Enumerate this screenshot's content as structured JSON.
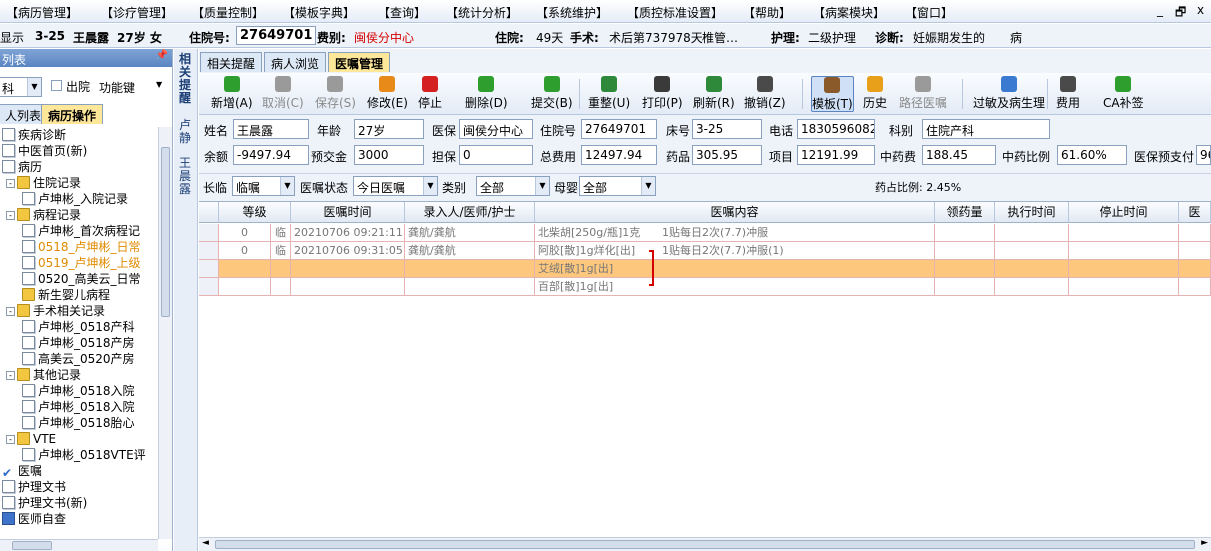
{
  "menu": [
    "【病历管理】",
    "【诊疗管理】",
    "【质量控制】",
    "【模板字典】",
    "【查询】",
    "【统计分析】",
    "【系统维护】",
    "【质控标准设置】",
    "【帮助】",
    "【病案模块】",
    "【窗口】"
  ],
  "window_controls": [
    "_",
    "🗗",
    "x"
  ],
  "infobar": {
    "prefix": "显示",
    "bed": "3-25",
    "patient_name": "王晨露",
    "age_sex": "27岁 女",
    "admission_label": "住院号:",
    "admission_no": "27649701",
    "fee_type_label": "费别:",
    "fee_type": "闽侯分中心",
    "stay_label": "住院:",
    "stay_days": "49天",
    "surgery_label": "手术:",
    "surgery": "术后第737978天",
    "surgery_more": "椎管…",
    "nursing_label": "护理:",
    "nursing": "二级护理",
    "diagnosis_label": "诊断:",
    "diagnosis": "妊娠期发生的",
    "diagnosis_more": "病"
  },
  "left_panel": {
    "title": "列表",
    "combo_value": "科",
    "checkbox_label": "出院",
    "function_key": "功能键",
    "tabs": [
      "人列表",
      "病历操作"
    ],
    "tree": [
      {
        "label": "疾病诊断",
        "level": 0,
        "icon": "doc"
      },
      {
        "label": "中医首页(新)",
        "level": 0,
        "icon": "doc"
      },
      {
        "label": "病历",
        "level": 0,
        "icon": "doc"
      },
      {
        "label": "住院记录",
        "level": 1,
        "icon": "folder",
        "expander": "-"
      },
      {
        "label": "卢坤彬_入院记录",
        "level": 2,
        "icon": "doc"
      },
      {
        "label": "病程记录",
        "level": 1,
        "icon": "folder",
        "expander": "-"
      },
      {
        "label": "卢坤彬_首次病程记",
        "level": 2,
        "icon": "doc"
      },
      {
        "label": "0518_卢坤彬_日常",
        "level": 2,
        "icon": "doc",
        "highlight": true
      },
      {
        "label": "0519_卢坤彬_上级",
        "level": 2,
        "icon": "doc",
        "highlight": true
      },
      {
        "label": "0520_高美云_日常",
        "level": 2,
        "icon": "doc"
      },
      {
        "label": "新生婴儿病程",
        "level": 2,
        "icon": "folder"
      },
      {
        "label": "手术相关记录",
        "level": 1,
        "icon": "folder",
        "expander": "-"
      },
      {
        "label": "卢坤彬_0518产科",
        "level": 2,
        "icon": "doc"
      },
      {
        "label": "卢坤彬_0518产房",
        "level": 2,
        "icon": "doc"
      },
      {
        "label": "高美云_0520产房",
        "level": 2,
        "icon": "doc"
      },
      {
        "label": "其他记录",
        "level": 1,
        "icon": "folder",
        "expander": "-"
      },
      {
        "label": "卢坤彬_0518入院",
        "level": 2,
        "icon": "doc"
      },
      {
        "label": "卢坤彬_0518入院",
        "level": 2,
        "icon": "doc"
      },
      {
        "label": "卢坤彬_0518胎心",
        "level": 2,
        "icon": "doc"
      },
      {
        "label": "VTE",
        "level": 1,
        "icon": "folder",
        "expander": "-"
      },
      {
        "label": "卢坤彬_0518VTE评",
        "level": 2,
        "icon": "doc"
      },
      {
        "label": "医嘱",
        "level": 0,
        "icon": "check"
      },
      {
        "label": "护理文书",
        "level": 0,
        "icon": "doc"
      },
      {
        "label": "护理文书(新)",
        "level": 0,
        "icon": "doc"
      },
      {
        "label": "医师自查",
        "level": 0,
        "icon": "book"
      }
    ]
  },
  "vertical_strip": {
    "top": "相关提醒",
    "middle": "卢静",
    "bottom": "王晨露"
  },
  "main_tabs": [
    "相关提醒",
    "病人浏览",
    "医嘱管理"
  ],
  "toolbar": [
    {
      "label": "新增(A)",
      "icon": "add-icon",
      "color": "#2e9e2e",
      "disabled": false
    },
    {
      "label": "取消(C)",
      "icon": "undo-icon",
      "color": "#9a9a9a",
      "disabled": true
    },
    {
      "label": "保存(S)",
      "icon": "save-icon",
      "color": "#9a9a9a",
      "disabled": true
    },
    {
      "label": "修改(E)",
      "icon": "edit-icon",
      "color": "#e88a1a",
      "disabled": false
    },
    {
      "label": "停止",
      "icon": "stop-icon",
      "color": "#d42020",
      "disabled": false
    },
    {
      "label": "删除(D)",
      "icon": "delete-icon",
      "color": "#2e9e2e",
      "disabled": false
    },
    {
      "label": "提交(B)",
      "icon": "submit-icon",
      "color": "#2e9e2e",
      "disabled": false
    },
    {
      "label": "重整(U)",
      "icon": "reorganize-icon",
      "color": "#2e8a3a",
      "disabled": false
    },
    {
      "label": "打印(P)",
      "icon": "printer-icon",
      "color": "#3a3a3a",
      "disabled": false
    },
    {
      "label": "刷新(R)",
      "icon": "refresh-icon",
      "color": "#2e8a3a",
      "disabled": false
    },
    {
      "label": "撤销(Z)",
      "icon": "trash-icon",
      "color": "#4a4a4a",
      "disabled": false
    },
    {
      "label": "模板(T)",
      "icon": "template-icon",
      "color": "#8a5a2a",
      "disabled": false
    },
    {
      "label": "历史",
      "icon": "history-icon",
      "color": "#e8a01a",
      "disabled": false
    },
    {
      "label": "路径医嘱",
      "icon": "pathway-icon",
      "color": "#9a9a9a",
      "disabled": true
    },
    {
      "label": "过敏及病生理",
      "icon": "allergy-icon",
      "color": "#3a7ad0",
      "disabled": false
    },
    {
      "label": "费用",
      "icon": "calculator-icon",
      "color": "#4a4a4a",
      "disabled": false
    },
    {
      "label": "CA补签",
      "icon": "ca-sign-icon",
      "color": "#2e9e2e",
      "disabled": false
    }
  ],
  "form": {
    "name_label": "姓名",
    "name": "王晨露",
    "age_label": "年龄",
    "age": "27岁",
    "insurance_label": "医保",
    "insurance": "闽侯分中心",
    "admission_label": "住院号",
    "admission": "27649701",
    "bed_label": "床号",
    "bed": "3-25",
    "phone_label": "电话",
    "phone": "18305960826",
    "dept_label": "科别",
    "dept": "住院产科",
    "balance_label": "余额",
    "balance": "-9497.94",
    "deposit_label": "预交金",
    "deposit": "3000",
    "guarantee_label": "担保",
    "guarantee": "0",
    "total_label": "总费用",
    "total": "12497.94",
    "drug_label": "药品",
    "drug": "305.95",
    "item_label": "项目",
    "item": "12191.99",
    "tcm_fee_label": "中药费",
    "tcm_fee": "188.45",
    "tcm_ratio_label": "中药比例",
    "tcm_ratio": "61.60%",
    "prepay_label": "医保预支付",
    "prepay": "96"
  },
  "filter": {
    "long_temp_label": "长临",
    "long_temp": "临嘱",
    "status_label": "医嘱状态",
    "status": "今日医嘱",
    "category_label": "类别",
    "category": "全部",
    "mother_baby_label": "母婴",
    "mother_baby": "全部",
    "drug_ratio": "药占比例: 2.45%"
  },
  "grid": {
    "headers": [
      "等级",
      "医嘱时间",
      "录入人/医师/护士",
      "医嘱内容",
      "领药量",
      "执行时间",
      "停止时间",
      "医"
    ],
    "rows": [
      {
        "level": "0",
        "type": "临",
        "time": "20210706 09:21:11",
        "entered_by": "龚航/龚航",
        "content": "北柴胡[250g/瓶]1克",
        "note": "1贴每日2次(7.7)冲服"
      },
      {
        "level": "0",
        "type": "临",
        "time": "20210706 09:31:05",
        "entered_by": "龚航/龚航",
        "content": "阿胶[散]1g烊化[出]",
        "note": "1贴每日2次(7.7)冲服(1)"
      },
      {
        "level": "",
        "type": "",
        "time": "",
        "entered_by": "",
        "content": "艾绒[散]1g[出]",
        "note": ""
      },
      {
        "level": "",
        "type": "",
        "time": "",
        "entered_by": "",
        "content": "百部[散]1g[出]",
        "note": ""
      }
    ]
  },
  "colors": {
    "accent": "#5a85c2",
    "selected_row": "#fdc77e",
    "active_tab": "#ffe79a",
    "red": "#d40000"
  }
}
